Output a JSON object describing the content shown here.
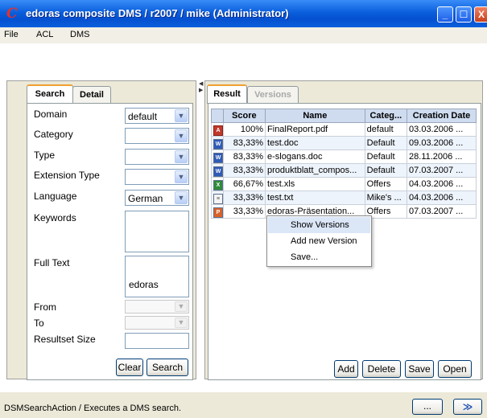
{
  "window": {
    "title": "edoras composite DMS / r2007 / mike (Administrator)",
    "buttons": {
      "minimize": "_",
      "maximize": "☐",
      "close": "X"
    }
  },
  "menu": [
    "File",
    "ACL",
    "DMS"
  ],
  "search_panel": {
    "tabs": {
      "search": "Search",
      "detail": "Detail"
    },
    "fields": {
      "domain": {
        "label": "Domain",
        "value": "default"
      },
      "category": {
        "label": "Category",
        "value": ""
      },
      "type": {
        "label": "Type",
        "value": ""
      },
      "extension_type": {
        "label": "Extension Type",
        "value": ""
      },
      "language": {
        "label": "Language",
        "value": "German"
      },
      "keywords": {
        "label": "Keywords",
        "value": ""
      },
      "full_text": {
        "label": "Full Text",
        "value": "edoras"
      },
      "from": {
        "label": "From",
        "value": ""
      },
      "to": {
        "label": "To",
        "value": ""
      },
      "resultset_size": {
        "label": "Resultset Size",
        "value": ""
      }
    },
    "buttons": {
      "clear": "Clear",
      "search": "Search"
    }
  },
  "result_panel": {
    "tabs": {
      "result": "Result",
      "versions": "Versions"
    },
    "columns": [
      "Score",
      "Name",
      "Categ...",
      "Creation Date"
    ],
    "rows": [
      {
        "icon": "pdf-file-icon",
        "score": "100%",
        "name": "FinalReport.pdf",
        "category": "default",
        "date": "03.03.2006 ..."
      },
      {
        "icon": "word-doc-icon",
        "score": "83,33%",
        "name": "test.doc",
        "category": "Default",
        "date": "09.03.2006 ..."
      },
      {
        "icon": "word-doc-icon",
        "score": "83,33%",
        "name": "e-slogans.doc",
        "category": "Default",
        "date": "28.11.2006 ..."
      },
      {
        "icon": "word-doc-icon",
        "score": "83,33%",
        "name": "produktblatt_compos...",
        "category": "Default",
        "date": "07.03.2007 ..."
      },
      {
        "icon": "excel-sheet-icon",
        "score": "66,67%",
        "name": "test.xls",
        "category": "Offers",
        "date": "04.03.2006 ..."
      },
      {
        "icon": "text-file-icon",
        "score": "33,33%",
        "name": "test.txt",
        "category": "Mike's ...",
        "date": "04.03.2006 ..."
      },
      {
        "icon": "presentation-file-icon",
        "score": "33,33%",
        "name": "edoras-Präsentation...",
        "category": "Offers",
        "date": "07.03.2007 ..."
      }
    ],
    "buttons": {
      "add": "Add",
      "delete": "Delete",
      "save": "Save",
      "open": "Open"
    }
  },
  "context_menu": [
    "Show Versions",
    "Add new Version",
    "Save..."
  ],
  "status": {
    "text": "DSMSearchAction / Executes a DMS search.",
    "more_button": "...",
    "collapse_button": "≫"
  },
  "colors": {
    "title_bar": "#0a5fdc",
    "tab_accent": "#f0a030",
    "header_blue": "#cfdcf0"
  }
}
